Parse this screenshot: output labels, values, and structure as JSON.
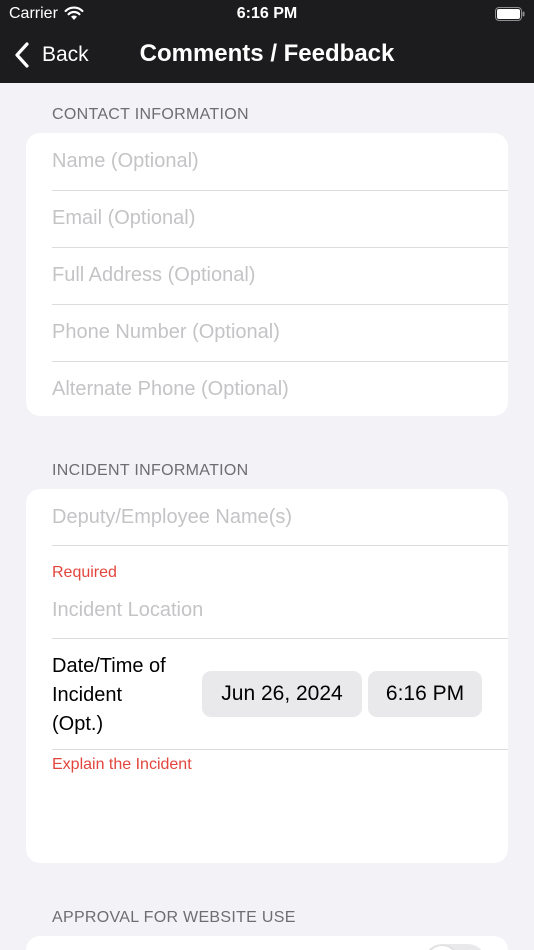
{
  "status_bar": {
    "carrier": "Carrier",
    "time": "6:16 PM"
  },
  "nav": {
    "back_label": "Back",
    "title": "Comments / Feedback"
  },
  "contact": {
    "header": "CONTACT INFORMATION",
    "fields": [
      {
        "placeholder": "Name (Optional)",
        "value": ""
      },
      {
        "placeholder": "Email (Optional)",
        "value": ""
      },
      {
        "placeholder": "Full Address (Optional)",
        "value": ""
      },
      {
        "placeholder": "Phone Number (Optional)",
        "value": ""
      },
      {
        "placeholder": "Alternate Phone (Optional)",
        "value": ""
      }
    ]
  },
  "incident": {
    "header": "INCIDENT INFORMATION",
    "employee_placeholder": "Deputy/Employee Name(s)",
    "required_label": "Required",
    "location_placeholder": "Incident Location",
    "datetime_label_lines": [
      "Date/Time of",
      "Incident",
      "(Opt.)"
    ],
    "date_value": "Jun 26, 2024",
    "time_value": "6:16 PM",
    "explain_label": "Explain the Incident"
  },
  "approval": {
    "header": "APPROVAL FOR WEBSITE USE",
    "toggle_on": false
  },
  "colors": {
    "nav_bg": "#1c1c1e",
    "page_bg": "#f2f2f7",
    "required": "#e2453c",
    "placeholder": "#c4c4c7"
  }
}
